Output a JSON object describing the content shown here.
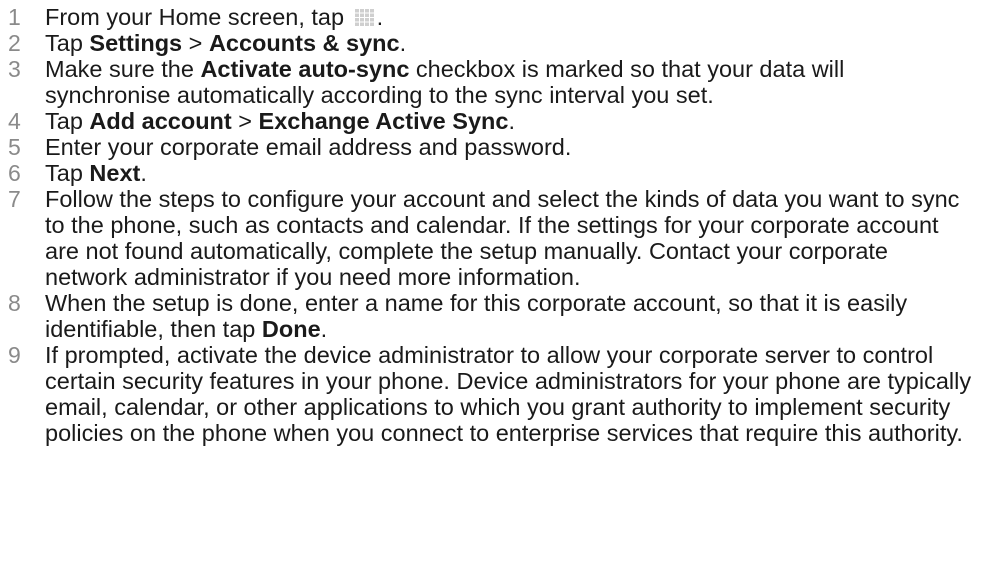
{
  "steps": [
    {
      "number": "1",
      "segments": [
        {
          "text": "From your Home screen, tap "
        },
        {
          "icon": "apps-grid-icon"
        },
        {
          "text": "."
        }
      ]
    },
    {
      "number": "2",
      "segments": [
        {
          "text": "Tap "
        },
        {
          "text": "Settings",
          "bold": true
        },
        {
          "text": " > "
        },
        {
          "text": "Accounts & sync",
          "bold": true
        },
        {
          "text": "."
        }
      ]
    },
    {
      "number": "3",
      "segments": [
        {
          "text": "Make sure the "
        },
        {
          "text": "Activate auto-sync",
          "bold": true
        },
        {
          "text": " checkbox is marked so that your data will synchronise automatically according to the sync interval you set."
        }
      ]
    },
    {
      "number": "4",
      "segments": [
        {
          "text": "Tap "
        },
        {
          "text": "Add account",
          "bold": true
        },
        {
          "text": " > "
        },
        {
          "text": "Exchange Active Sync",
          "bold": true
        },
        {
          "text": "."
        }
      ]
    },
    {
      "number": "5",
      "segments": [
        {
          "text": "Enter your corporate email address and password."
        }
      ]
    },
    {
      "number": "6",
      "segments": [
        {
          "text": "Tap "
        },
        {
          "text": "Next",
          "bold": true
        },
        {
          "text": "."
        }
      ]
    },
    {
      "number": "7",
      "segments": [
        {
          "text": "Follow the steps to configure your account and select the kinds of data you want to sync to the phone, such as contacts and calendar. If the settings for your corporate account are not found automatically, complete the setup manually. Contact your corporate network administrator if you need more information."
        }
      ]
    },
    {
      "number": "8",
      "segments": [
        {
          "text": "When the setup is done, enter a name for this corporate account, so that it is easily identifiable, then tap "
        },
        {
          "text": "Done",
          "bold": true
        },
        {
          "text": "."
        }
      ]
    },
    {
      "number": "9",
      "segments": [
        {
          "text": "If prompted, activate the device administrator to allow your corporate server to control certain security features in your phone. Device administrators for your phone are typically email, calendar, or other applications to which you grant authority to implement security policies on the phone when you connect to enterprise services that require this authority."
        }
      ]
    }
  ],
  "colors": {
    "text": "#1a1a1a",
    "step_number": "#8a8a8a",
    "icon_grid": "#cfcfcf"
  }
}
